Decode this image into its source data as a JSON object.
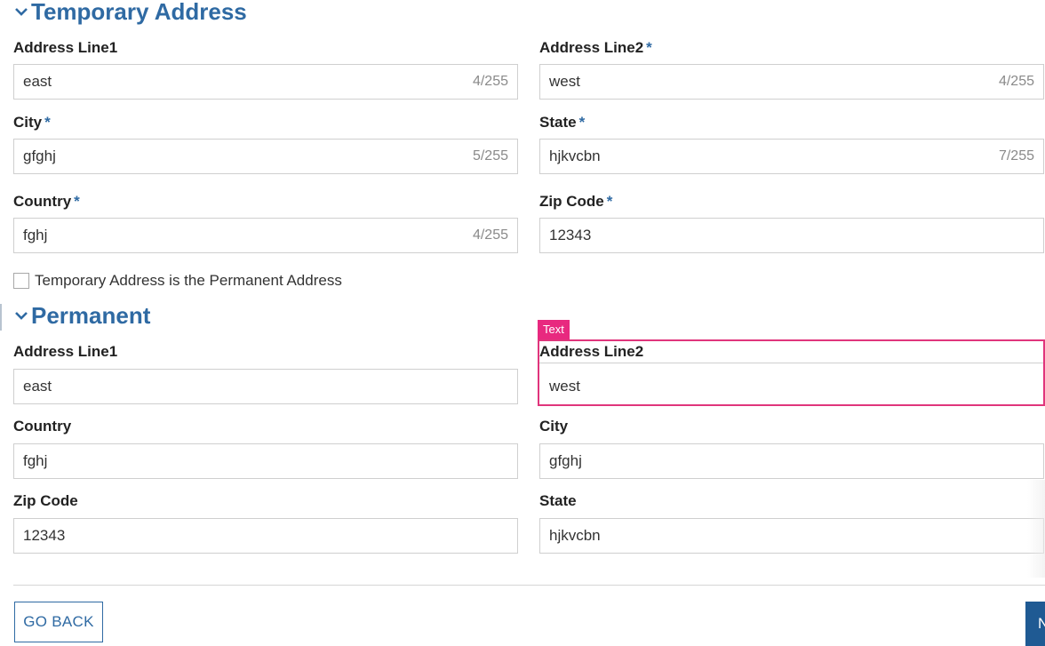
{
  "temporary": {
    "title": "Temporary Address",
    "address_line1": {
      "label": "Address Line1",
      "value": "east",
      "count": "4/255"
    },
    "address_line2": {
      "label": "Address Line2",
      "required": "*",
      "value": "west",
      "count": "4/255"
    },
    "city": {
      "label": "City",
      "required": "*",
      "value": "gfghj",
      "count": "5/255"
    },
    "state": {
      "label": "State",
      "required": "*",
      "value": "hjkvcbn",
      "count": "7/255"
    },
    "country": {
      "label": "Country",
      "required": "*",
      "value": "fghj",
      "count": "4/255"
    },
    "zip": {
      "label": "Zip Code",
      "required": "*",
      "value": "12343"
    },
    "same_checkbox_label": "Temporary Address is the Permanent Address"
  },
  "permanent": {
    "title": "Permanent",
    "address_line1": {
      "label": "Address Line1",
      "value": "east"
    },
    "address_line2": {
      "label": "Address Line2",
      "value": "west"
    },
    "country": {
      "label": "Country",
      "value": "fghj"
    },
    "city": {
      "label": "City",
      "value": "gfghj"
    },
    "zip": {
      "label": "Zip Code",
      "value": "12343"
    },
    "state": {
      "label": "State",
      "value": "hjkvcbn"
    }
  },
  "highlight": {
    "tag": "Text",
    "color": "#e8297f"
  },
  "buttons": {
    "back": "GO BACK",
    "next": "N"
  },
  "colors": {
    "accent": "#2f6aa3",
    "primary_button": "#1f5a93"
  }
}
